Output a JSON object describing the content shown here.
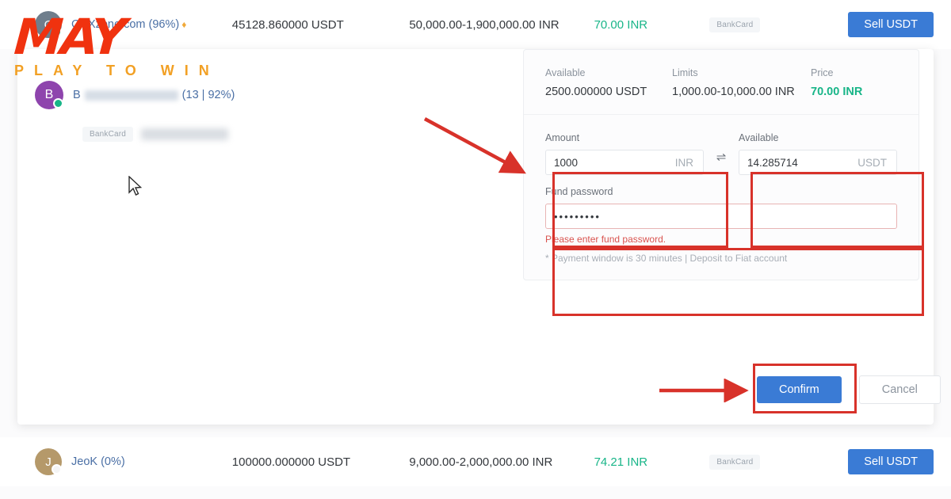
{
  "watermark": {
    "logo_text": "MAY",
    "tagline": "PLAY TO WIN",
    "logo_color": "#f0320f",
    "tagline_color": "#f2a024"
  },
  "rows": [
    {
      "avatar_letter": "C",
      "avatar_color": "#6f7e8c",
      "merchant": "CRXzone.com (96%)",
      "badge_icon": "gem-icon",
      "amount": "45128.860000 USDT",
      "limits": "50,000.00-1,900,000.00 INR",
      "price": "70.00 INR",
      "payment": "BankCard",
      "action": "Sell USDT"
    },
    {
      "avatar_letter": "J",
      "avatar_color": "#b5996a",
      "merchant": "JeoK (0%)",
      "amount": "100000.000000 USDT",
      "limits": "9,000.00-2,000,000.00 INR",
      "price": "74.21 INR",
      "payment": "BankCard",
      "action": "Sell USDT"
    }
  ],
  "expanded": {
    "avatar_letter": "B",
    "avatar_color": "#8e44ad",
    "merchant_prefix": "B",
    "merchant_stats": "(13 | 92%)",
    "payment": "BankCard"
  },
  "detail": {
    "header": {
      "available_label": "Available",
      "available_value": "2500.000000 USDT",
      "limits_label": "Limits",
      "limits_value": "1,000.00-10,000.00 INR",
      "price_label": "Price",
      "price_value": "70.00 INR",
      "price_color": "#18b588"
    },
    "amount_field": {
      "label": "Amount",
      "value": "1000",
      "placeholder": "Amount",
      "suffix": "INR"
    },
    "swap_icon": "⇌",
    "available_field": {
      "label": "Available",
      "value": "14.285714",
      "placeholder": "Available",
      "suffix": "USDT"
    },
    "fund_password": {
      "label": "Fund password",
      "value": "•••••••••",
      "placeholder": "Fund password",
      "error": "Please enter fund password."
    },
    "note": "* Payment window is 30 minutes  |  Deposit to Fiat account"
  },
  "actions": {
    "confirm": "Confirm",
    "cancel": "Cancel"
  },
  "annotation": {
    "color": "#d8322a"
  }
}
